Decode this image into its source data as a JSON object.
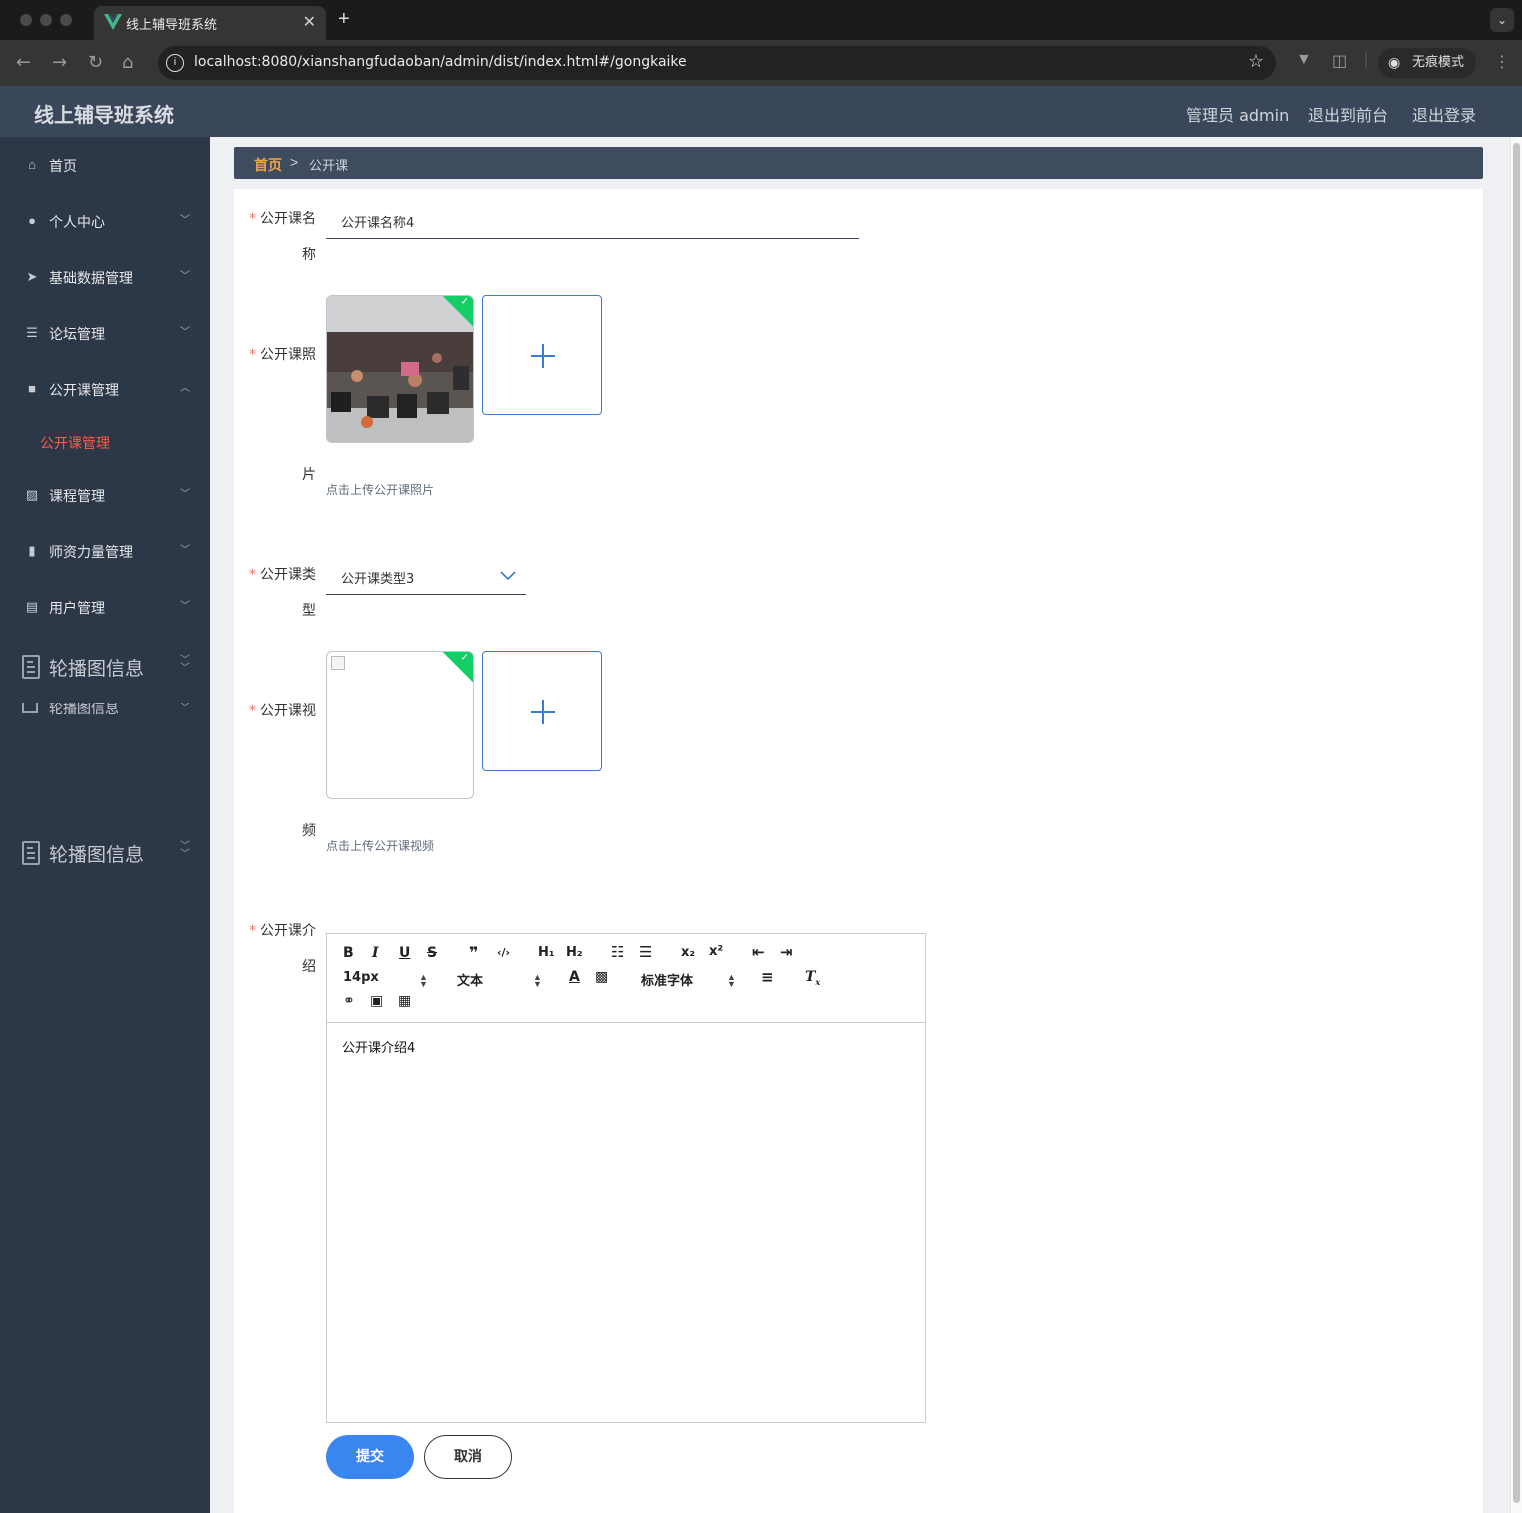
{
  "browser": {
    "tab_title": "线上辅导班系统",
    "tab_close": "✕",
    "new_tab": "+",
    "url": "localhost:8080/xianshangfudaoban/admin/dist/index.html#/gongkaike",
    "incognito_label": "无痕模式",
    "tab_logo_color": "#41b883"
  },
  "header": {
    "title": "线上辅导班系统",
    "user": "管理员 admin",
    "back_to_front": "退出到前台",
    "logout": "退出登录"
  },
  "sidebar": {
    "items": [
      {
        "label": "首页",
        "icon": "home-icon"
      },
      {
        "label": "个人中心",
        "icon": "user-icon"
      },
      {
        "label": "基础数据管理",
        "icon": "send-icon"
      },
      {
        "label": "论坛管理",
        "icon": "list-icon"
      },
      {
        "label": "公开课管理",
        "icon": "video-icon",
        "expanded": true
      },
      {
        "label": "课程管理",
        "icon": "chart-icon"
      },
      {
        "label": "师资力量管理",
        "icon": "book-icon"
      },
      {
        "label": "用户管理",
        "icon": "shop-icon"
      }
    ],
    "active_subitem": "公开课管理",
    "carousel_label": "轮播图信息",
    "active_color": "#ff5a4a"
  },
  "breadcrumb": {
    "home": "首页",
    "separator": ">",
    "current": "公开课"
  },
  "form": {
    "name": {
      "label_line1": "公开课名",
      "label_line2": "称",
      "value": "公开课名称4"
    },
    "photo": {
      "label_line1": "公开课照",
      "label_line2": "片",
      "tip": "点击上传公开课照片"
    },
    "type": {
      "label_line1": "公开课类",
      "label_line2": "型",
      "value": "公开课类型3"
    },
    "video": {
      "label_line1": "公开课视",
      "label_line2": "频",
      "tip": "点击上传公开课视频"
    },
    "intro": {
      "label_line1": "公开课介",
      "label_line2": "绍",
      "content": "公开课介绍4"
    },
    "required_mark": "*"
  },
  "editor": {
    "font_size": "14px",
    "header_select": "文本",
    "font_family": "标准字体"
  },
  "buttons": {
    "submit": "提交",
    "cancel": "取消",
    "submit_color": "#3a86f0"
  }
}
